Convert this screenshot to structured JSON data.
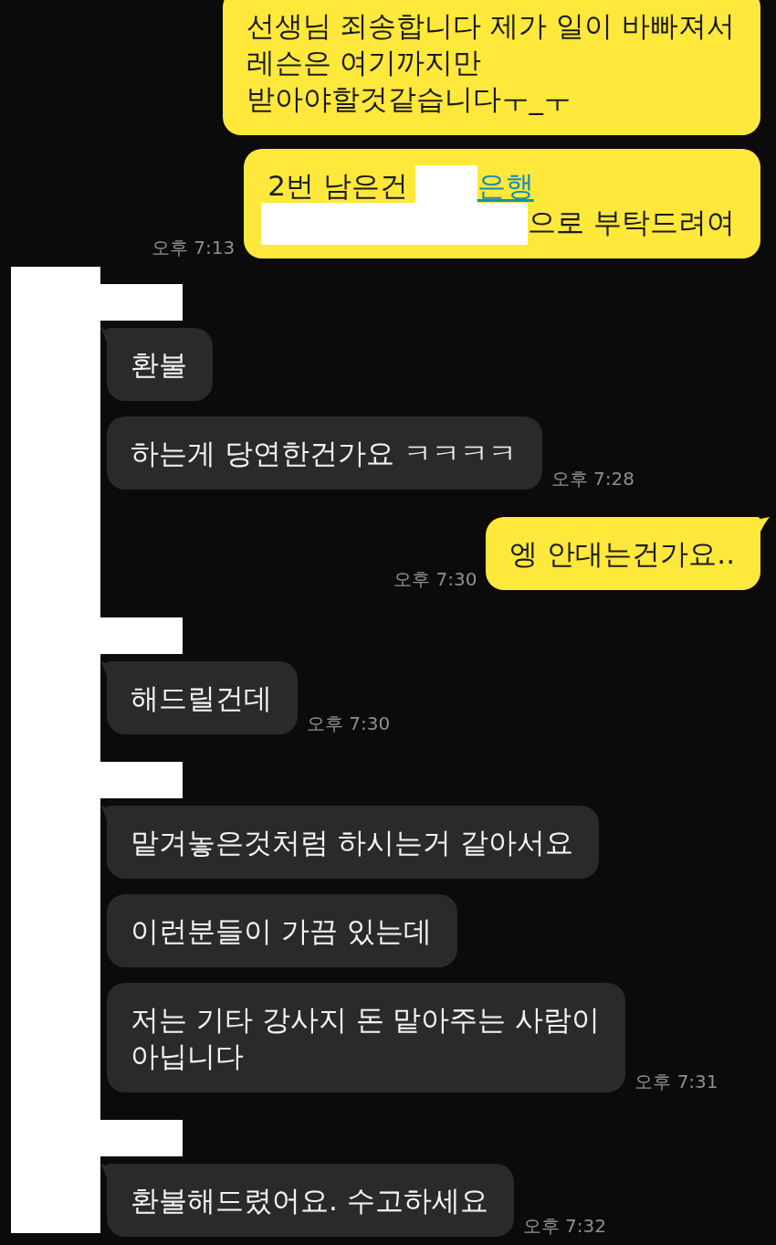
{
  "chat_top": {
    "groups": [
      {
        "kind": "outgoing",
        "messages": [
          {
            "tail": false,
            "text": "선생님 죄송합니다 제가 일이 바빠져서\n레슨은 여기까지만\n받아야할것같습니다ㅜ_ㅜ"
          },
          {
            "tail": false,
            "lines": [
              [
                {
                  "kind": "text",
                  "text": "2번 남은건"
                },
                {
                  "kind": "redaction"
                },
                {
                  "kind": "link",
                  "text": "은행"
                }
              ],
              [
                {
                  "kind": "redaction"
                },
                {
                  "kind": "text",
                  "text": "으로 부탁드려여"
                }
              ]
            ],
            "time": "오후 7:13"
          }
        ]
      }
    ]
  },
  "chat_redacted_area": {
    "strip": true,
    "groups": [
      {
        "kind": "incoming",
        "name_redacted": true,
        "messages": [
          {
            "tail": true,
            "text": "환불"
          },
          {
            "tail": false,
            "text": "하는게 당연한건가요 ㅋㅋㅋㅋ",
            "time": "오후 7:28"
          }
        ]
      },
      {
        "kind": "outgoing",
        "messages": [
          {
            "tail": true,
            "text": "엥 안대는건가요..",
            "time": "오후 7:30"
          }
        ]
      },
      {
        "kind": "incoming",
        "name_redacted": true,
        "messages": [
          {
            "tail": true,
            "text": "해드릴건데",
            "time": "오후 7:30"
          }
        ]
      },
      {
        "kind": "incoming",
        "name_redacted": true,
        "messages": [
          {
            "tail": true,
            "text": "맡겨놓은것처럼 하시는거 같아서요"
          },
          {
            "tail": false,
            "text": "이런분들이 가끔 있는데"
          },
          {
            "tail": false,
            "text": "저는 기타 강사지 돈 맡아주는 사람이\n아닙니다",
            "time": "오후 7:31"
          }
        ]
      },
      {
        "kind": "incoming",
        "name_redacted": true,
        "messages": [
          {
            "tail": true,
            "text": "환불해드렸어요. 수고하세요",
            "time": "오후 7:32"
          }
        ]
      }
    ]
  }
}
